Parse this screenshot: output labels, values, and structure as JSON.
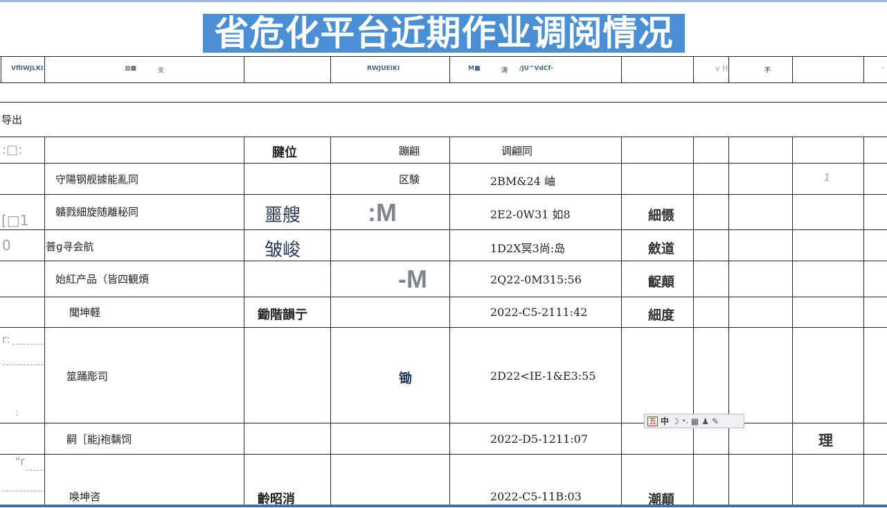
{
  "title": "省危化平台近期作业调阅情况",
  "header_row": {
    "c1": "VflIWJLKI",
    "c2a": "▩■",
    "c2b": "㕜",
    "c4": "RWJUEIKI",
    "c5a": "M■",
    "c5b": "涛",
    "c5c": "/JU^VdCf-",
    "c7": "v H",
    "c8": "不",
    "c10": "·"
  },
  "export_label": "导出",
  "column_headers": {
    "c0": ":□:",
    "c2": "腱位",
    "c4": "蹦翩",
    "c5": "调翩同"
  },
  "rows": [
    {
      "name": "守陽钢舰據能亂同",
      "c4": "区験",
      "time": "2BM&24 岫",
      "c9": "1"
    },
    {
      "left": "[□1",
      "name": "贛戮細旋随離秘同",
      "c2": "噩艘",
      "c3": ":M",
      "time": "2E2-0W31 如8",
      "c6": "細慑"
    },
    {
      "left": "0",
      "name": "普g寻会航",
      "c2": "皱峻",
      "time": "1D2X冥3尚:岛",
      "c6": "斂道"
    },
    {
      "name": "始紅产品（皆四観煩",
      "c3": "-M",
      "time": "2Q22-0M315:56",
      "c6": "齪顛"
    },
    {
      "name": "聞坤軽",
      "c2": "鋤階韻亍",
      "time": "2022-C5-2111:42",
      "c6": "細度"
    },
    {
      "left": "r:",
      "left2": ":",
      "name": "筮踊彫司",
      "c4": "锄",
      "time": "2D22<IE-1&E3:55"
    },
    {
      "name": "嗣［能j袍黐饲",
      "time": "2022-D5-1211:07",
      "c9": "理"
    },
    {
      "left": "\"r",
      "name": "唤坤咨",
      "c2": "齡昭消",
      "time": "2022-C5-11B:03",
      "c6": "潮顛"
    }
  ],
  "ime_toolbar": {
    "logo": "五",
    "mode": "中",
    "moon": "☽",
    "punct": "•,",
    "keyboard": "▦",
    "user": "♟",
    "settings": "✎"
  }
}
